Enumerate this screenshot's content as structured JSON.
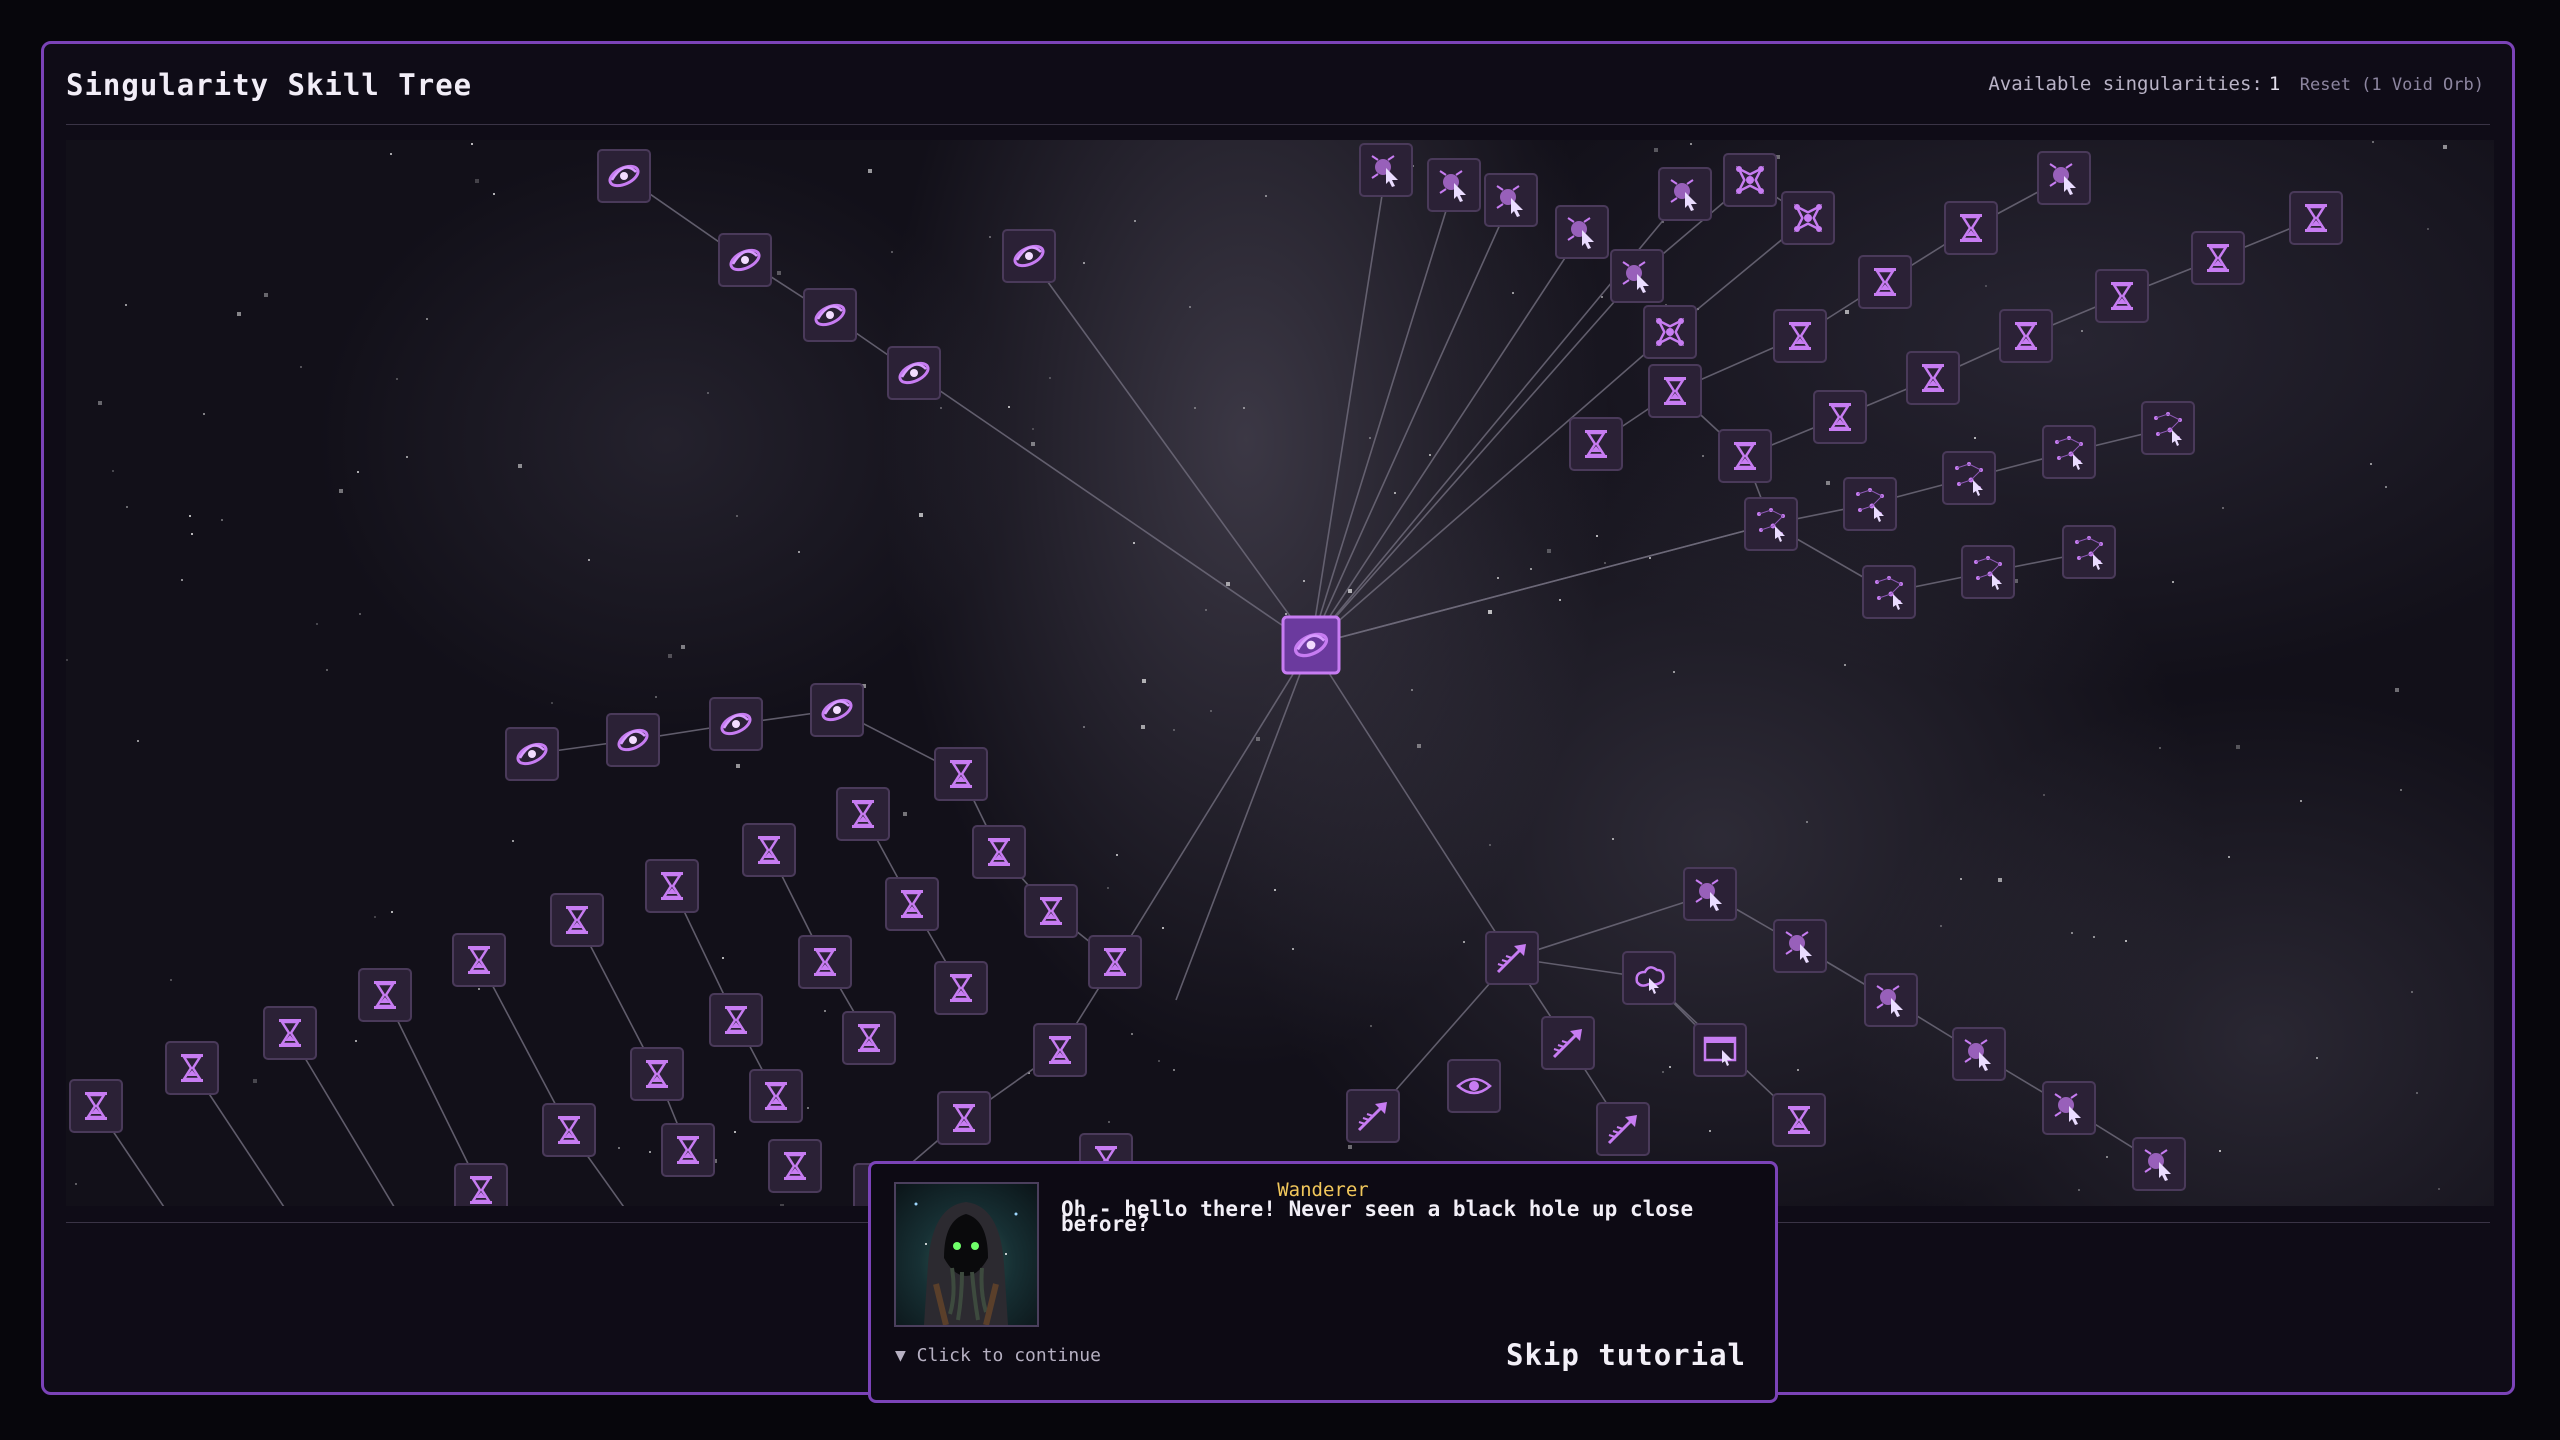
{
  "title": "Singularity Skill Tree",
  "resources": {
    "label": "Available singularities:",
    "count": "1",
    "reset_label": "Reset (1 Void Orb)"
  },
  "colors": {
    "accent": "#7b43b8",
    "node_glyph": "#c77cf2",
    "node_fill": "#2b2136",
    "edge": "#6e6a7a",
    "speaker": "#f1c75b"
  },
  "skill_tree": {
    "root_icon": "galaxy-icon",
    "node_icons": [
      "galaxy-icon",
      "hourglass-icon",
      "cursor-star-icon",
      "sparkle-cursor-icon",
      "constellation-cursor-icon",
      "arrow-icon",
      "shuriken-icon",
      "cloud-cursor-icon",
      "window-cursor-icon",
      "eye-icon"
    ]
  },
  "dialog": {
    "speaker": "Wanderer",
    "text": "Oh - hello there! Never seen a black hole up close before?",
    "continue_label": "▼ Click to continue",
    "skip_label": "Skip tutorial",
    "portrait_icon": "hooded-wanderer-portrait"
  }
}
